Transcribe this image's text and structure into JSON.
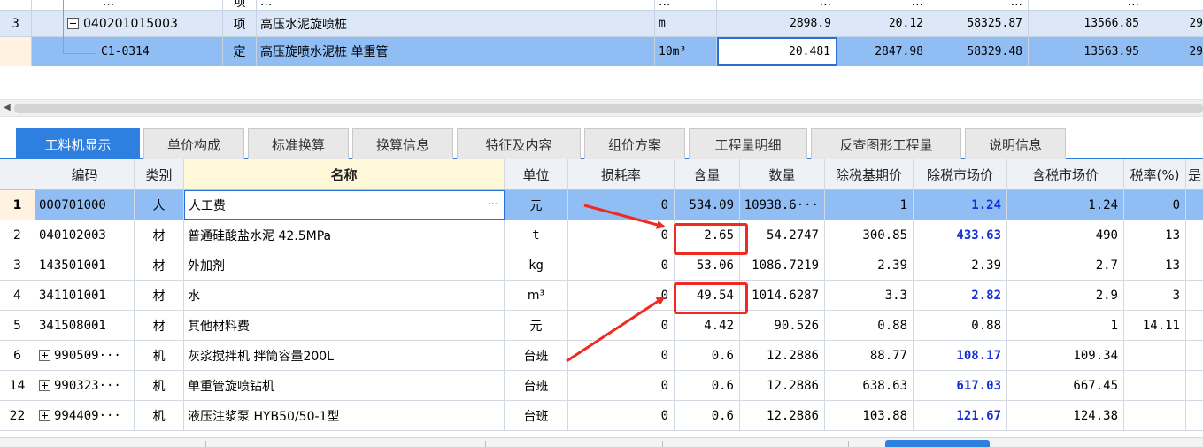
{
  "upper": {
    "partial_row": {
      "code": "...",
      "type": "项",
      "name": "...",
      "unit": "...",
      "qty": "...",
      "price": "...",
      "total": "...",
      "other": "..."
    },
    "rows": [
      {
        "num": "3",
        "code": "040201015003",
        "type": "项",
        "name": "高压水泥旋喷桩",
        "unit": "m",
        "qty": "2898.9",
        "price": "20.12",
        "total": "58325.87",
        "other": "13566.85",
        "cut": "29"
      },
      {
        "num": "",
        "code": "C1-0314",
        "type": "定",
        "name": "高压旋喷水泥桩 单重管",
        "unit": "10m³",
        "qty": "20.481",
        "price": "2847.98",
        "total": "58329.48",
        "other": "13563.95",
        "cut": "29"
      }
    ]
  },
  "tabs": [
    {
      "label": "工料机显示",
      "active": true
    },
    {
      "label": "单价构成"
    },
    {
      "label": "标准换算"
    },
    {
      "label": "换算信息"
    },
    {
      "label": "特征及内容"
    },
    {
      "label": "组价方案"
    },
    {
      "label": "工程量明细"
    },
    {
      "label": "反查图形工程量"
    },
    {
      "label": "说明信息"
    }
  ],
  "grid": {
    "headers": [
      "编码",
      "类别",
      "名称",
      "单位",
      "损耗率",
      "含量",
      "数量",
      "除税基期价",
      "除税市场价",
      "含税市场价",
      "税率(%)",
      "是"
    ],
    "rows": [
      {
        "rn": "1",
        "code": "000701000",
        "type": "人",
        "name": "人工费",
        "unit": "元",
        "loss": "0",
        "content": "534.09",
        "qty": "10938.6···",
        "base": "1",
        "market": "1.24",
        "tax_market": "1.24",
        "rate": "0"
      },
      {
        "rn": "2",
        "code": "040102003",
        "type": "材",
        "name": "普通硅酸盐水泥 42.5MPa",
        "unit": "t",
        "loss": "0",
        "content": "2.65",
        "qty": "54.2747",
        "base": "300.85",
        "market": "433.63",
        "tax_market": "490",
        "rate": "13"
      },
      {
        "rn": "3",
        "code": "143501001",
        "type": "材",
        "name": "外加剂",
        "unit": "kg",
        "loss": "0",
        "content": "53.06",
        "qty": "1086.7219",
        "base": "2.39",
        "market": "2.39",
        "tax_market": "2.7",
        "rate": "13"
      },
      {
        "rn": "4",
        "code": "341101001",
        "type": "材",
        "name": "水",
        "unit": "m³",
        "loss": "0",
        "content": "49.54",
        "qty": "1014.6287",
        "base": "3.3",
        "market": "2.82",
        "tax_market": "2.9",
        "rate": "3"
      },
      {
        "rn": "5",
        "code": "341508001",
        "type": "材",
        "name": "其他材料费",
        "unit": "元",
        "loss": "0",
        "content": "4.42",
        "qty": "90.526",
        "base": "0.88",
        "market": "0.88",
        "tax_market": "1",
        "rate": "14.11"
      },
      {
        "rn": "6",
        "code": "990509···",
        "type": "机",
        "name": "灰浆搅拌机 拌筒容量200L",
        "unit": "台班",
        "loss": "0",
        "content": "0.6",
        "qty": "12.2886",
        "base": "88.77",
        "market": "108.17",
        "tax_market": "109.34",
        "rate": ""
      },
      {
        "rn": "14",
        "code": "990323···",
        "type": "机",
        "name": "单重管旋喷钻机",
        "unit": "台班",
        "loss": "0",
        "content": "0.6",
        "qty": "12.2886",
        "base": "638.63",
        "market": "617.03",
        "tax_market": "667.45",
        "rate": ""
      },
      {
        "rn": "22",
        "code": "994409···",
        "type": "机",
        "name": "液压注浆泵 HYB50/50-1型",
        "unit": "台班",
        "loss": "0",
        "content": "0.6",
        "qty": "12.2886",
        "base": "103.88",
        "market": "121.67",
        "tax_market": "124.38",
        "rate": ""
      }
    ]
  },
  "colors": {
    "accent": "#2e7fe0",
    "selected_row": "#8fbdf4",
    "market_price": "#1530d8",
    "annotation": "#ee2a22"
  }
}
